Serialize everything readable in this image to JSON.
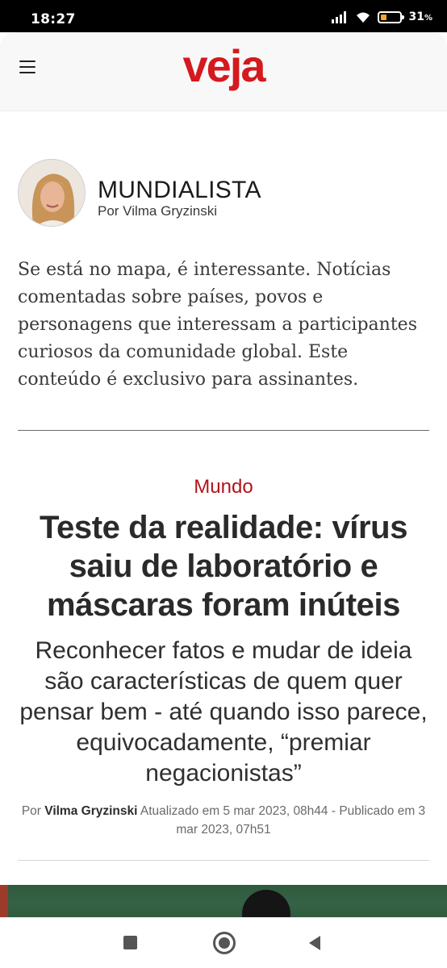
{
  "status_bar": {
    "time": "18:27",
    "battery_percent": "31",
    "battery_unit": "%",
    "battery_level": 0.31,
    "icons": [
      "signal-icon",
      "wifi-icon",
      "battery-icon"
    ]
  },
  "header": {
    "logo_text": "veja",
    "menu_icon": "hamburger-menu-icon",
    "brand_color": "#d4191f"
  },
  "column": {
    "name": "MUNDIALISTA",
    "author": "Por Vilma Gryzinski",
    "description": "Se está no mapa, é interessante. Notícias comentadas sobre países, povos e personagens que interessam a participantes curiosos da comunidade global. Este conteúdo é exclusivo para assinantes."
  },
  "article": {
    "category": "Mundo",
    "category_color": "#b2141a",
    "title": "Teste da realidade: vírus saiu de laboratório e máscaras foram inúteis",
    "subtitle": "Reconhecer fatos e mudar de ideia são características de quem quer pensar bem - até quando isso parece, equivocadamente, “premiar negacionistas”",
    "byline_prefix": "Por",
    "byline_author": "Vilma Gryzinski",
    "byline_dates": "Atualizado em 5 mar 2023, 08h44 - Publicado em 3 mar 2023, 07h51"
  },
  "nav_bar": {
    "buttons": [
      "recent-apps-icon",
      "home-icon",
      "back-icon"
    ]
  }
}
